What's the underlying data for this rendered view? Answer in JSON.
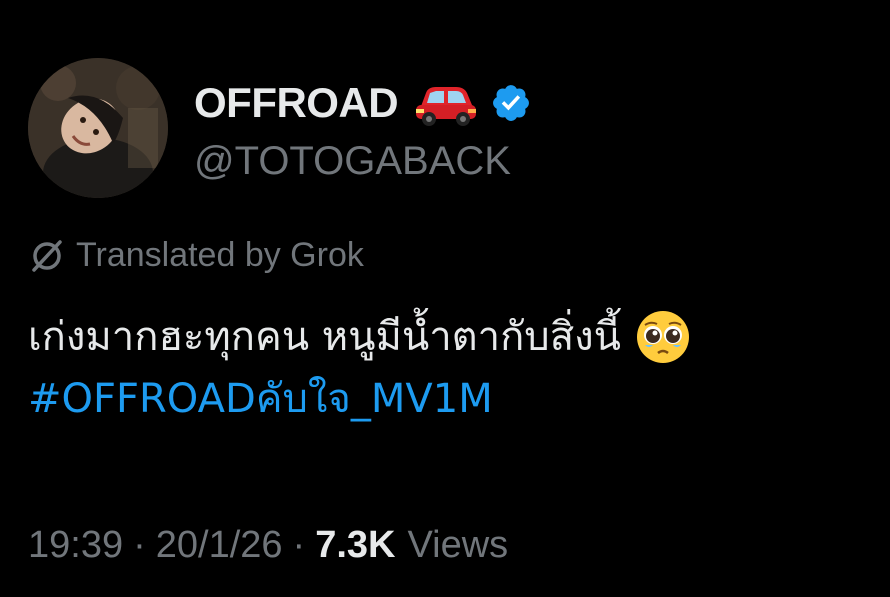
{
  "user": {
    "display_name": "OFFROAD",
    "handle": "@TOTOGABACK",
    "badge_icon": "verified-badge-icon",
    "name_emoji": "red-car-icon",
    "avatar": "profile-avatar"
  },
  "translation": {
    "icon": "grok-icon",
    "label": "Translated by Grok"
  },
  "tweet": {
    "text": "เก่งมากฮะทุกคน หนูมีน้ำตากับสิ่งนี้",
    "emoji": "pleading-face-icon",
    "hashtag": "#OFFROADคับใจ_MV1M"
  },
  "meta": {
    "time": "19:39",
    "date": "20/1/26",
    "separator": "·",
    "views_count": "7.3K",
    "views_label": "Views"
  },
  "colors": {
    "background": "#000000",
    "text_primary": "#e7e9ea",
    "text_secondary": "#71767b",
    "accent": "#1d9bf0"
  }
}
